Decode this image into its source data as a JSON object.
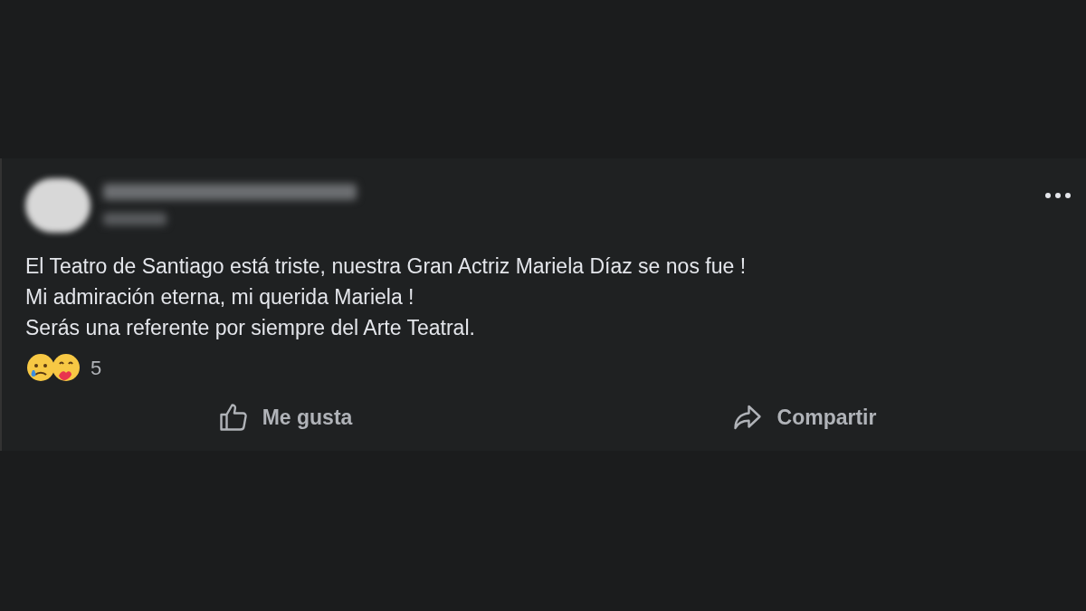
{
  "post": {
    "lines": [
      "El Teatro de Santiago está triste, nuestra Gran Actriz Mariela Díaz se nos fue !",
      "Mi admiración eterna, mi querida Mariela !",
      "Serás una referente por siempre del Arte Teatral."
    ],
    "reaction_count": "5",
    "actions": [
      {
        "kind": "like",
        "label": "Me gusta"
      },
      {
        "kind": "share",
        "label": "Compartir"
      }
    ]
  }
}
